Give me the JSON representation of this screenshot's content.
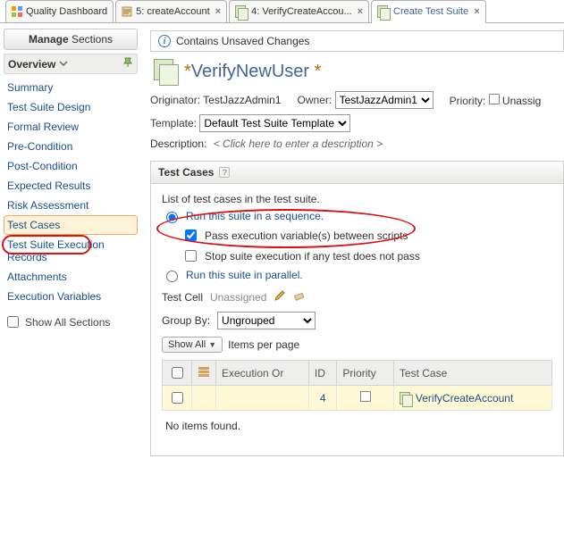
{
  "tabs": [
    {
      "label": "Quality Dashboard",
      "icon": "dashboard"
    },
    {
      "label": "5: createAccount",
      "icon": "plan"
    },
    {
      "label": "4: VerifyCreateAccou...",
      "icon": "suite"
    },
    {
      "label": "Create Test Suite",
      "icon": "suite",
      "active": true
    }
  ],
  "sidebar": {
    "manage_bold": "Manage",
    "manage_rest": " Sections",
    "overview": "Overview",
    "items": [
      "Summary",
      "Test Suite Design",
      "Formal Review",
      "Pre-Condition",
      "Post-Condition",
      "Expected Results",
      "Risk Assessment",
      "Test Cases",
      "Test Suite Execution Records",
      "Attachments",
      "Execution Variables"
    ],
    "selected_index": 7,
    "show_all": "Show All Sections"
  },
  "unsaved": "Contains Unsaved Changes",
  "title": {
    "dirty_prefix": "*",
    "name": "VerifyNewUser",
    "dirty_suffix": " *"
  },
  "meta": {
    "originator_label": "Originator:",
    "originator_value": "TestJazzAdmin1",
    "owner_label": "Owner:",
    "owner_value": "TestJazzAdmin1",
    "priority_label": "Priority:",
    "priority_value": "Unassig",
    "template_label": "Template:",
    "template_value": "Default Test Suite Template",
    "description_label": "Description:",
    "description_placeholder": "< Click here to enter a description >"
  },
  "section": {
    "header": "Test Cases",
    "intro": "List of test cases in the test suite.",
    "opt_sequence": "Run this suite in a sequence.",
    "opt_pass_vars": "Pass execution variable(s) between scripts",
    "opt_stop": "Stop suite execution if any test does not pass",
    "opt_parallel": "Run this suite in parallel.",
    "testcell_label": "Test Cell",
    "testcell_value": "Unassigned",
    "groupby_label": "Group By:",
    "groupby_value": "Ungrouped",
    "showall_btn": "Show All",
    "items_per_page": "Items per page",
    "columns": {
      "exec_order": "Execution Or",
      "id": "ID",
      "priority": "Priority",
      "testcase": "Test Case"
    },
    "rows": [
      {
        "id": "4",
        "priority": "",
        "name": "VerifyCreateAccount"
      }
    ],
    "no_items": "No items found."
  }
}
